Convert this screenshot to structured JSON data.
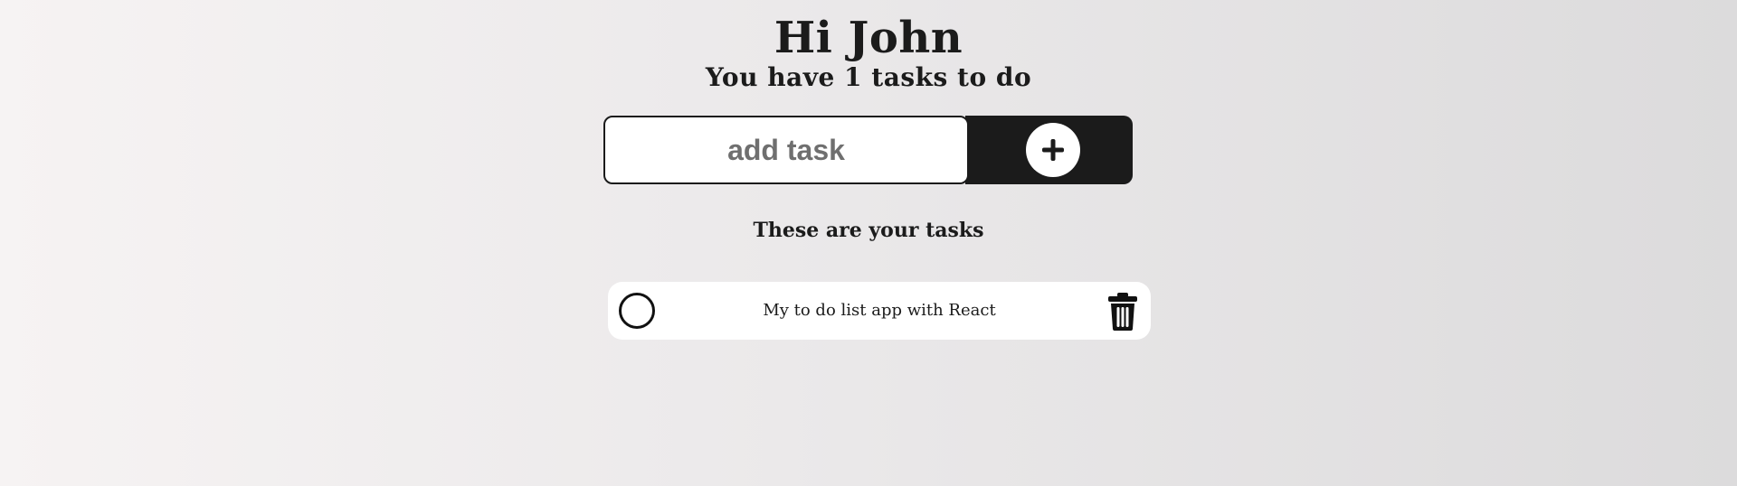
{
  "header": {
    "greeting": "Hi John",
    "summary": "You have 1 tasks to do"
  },
  "add_task": {
    "placeholder": "add task",
    "button_icon": "plus-icon"
  },
  "list": {
    "heading": "These are your tasks",
    "tasks": [
      {
        "text": "My to do list app with React",
        "completed": false,
        "check_icon": "circle-icon",
        "delete_icon": "trash-icon"
      }
    ]
  },
  "colors": {
    "dark": "#1b1b1b",
    "card": "#ffffff",
    "background_start": "#f6f3f3",
    "background_end": "#dcdbdc"
  }
}
